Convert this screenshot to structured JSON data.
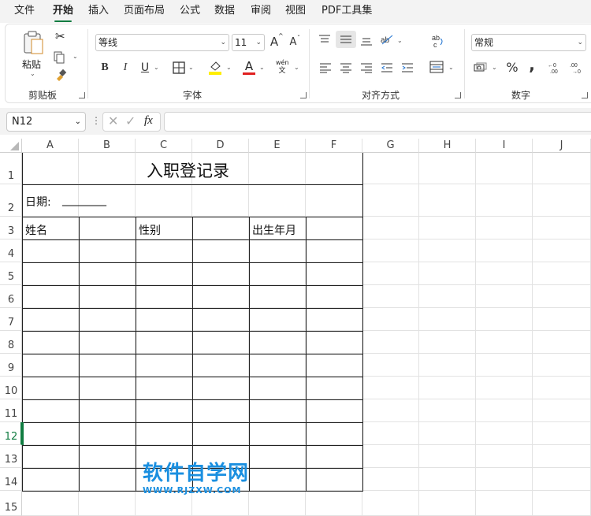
{
  "menu": [
    "文件",
    "开始",
    "插入",
    "页面布局",
    "公式",
    "数据",
    "审阅",
    "视图",
    "PDF工具集"
  ],
  "ribbon": {
    "clipboard": {
      "paste_label": "粘贴",
      "group_label": "剪贴板"
    },
    "font": {
      "font_name": "等线",
      "font_size": "11",
      "bold": "B",
      "italic": "I",
      "underline": "U",
      "grow": "A",
      "shrink": "A",
      "font_color": "A",
      "phonetic_top": "wén",
      "phonetic_bottom": "文",
      "group_label": "字体"
    },
    "alignment": {
      "group_label": "对齐方式"
    },
    "number": {
      "format": "常规",
      "percent": "%",
      "comma": ",",
      "group_label": "数字"
    }
  },
  "formula_bar": {
    "name_box": "N12",
    "fx": "fx",
    "formula": ""
  },
  "columns": [
    "A",
    "B",
    "C",
    "D",
    "E",
    "F",
    "G",
    "H",
    "I",
    "J"
  ],
  "rows": [
    "1",
    "2",
    "3",
    "4",
    "5",
    "6",
    "7",
    "8",
    "9",
    "10",
    "11",
    "12",
    "13",
    "14",
    "15"
  ],
  "active_row": "12",
  "sheet": {
    "title": "入职登记录",
    "date_label": "日期:",
    "date_blank": "________",
    "header_name": "姓名",
    "header_gender": "性别",
    "header_birth": "出生年月"
  },
  "watermark": {
    "main": "软件自学网",
    "sub": "WWW.RJZXW.COM"
  },
  "colors": {
    "accent": "#107c41",
    "watermark": "#1a8fe0",
    "active_row": "#107c41"
  }
}
